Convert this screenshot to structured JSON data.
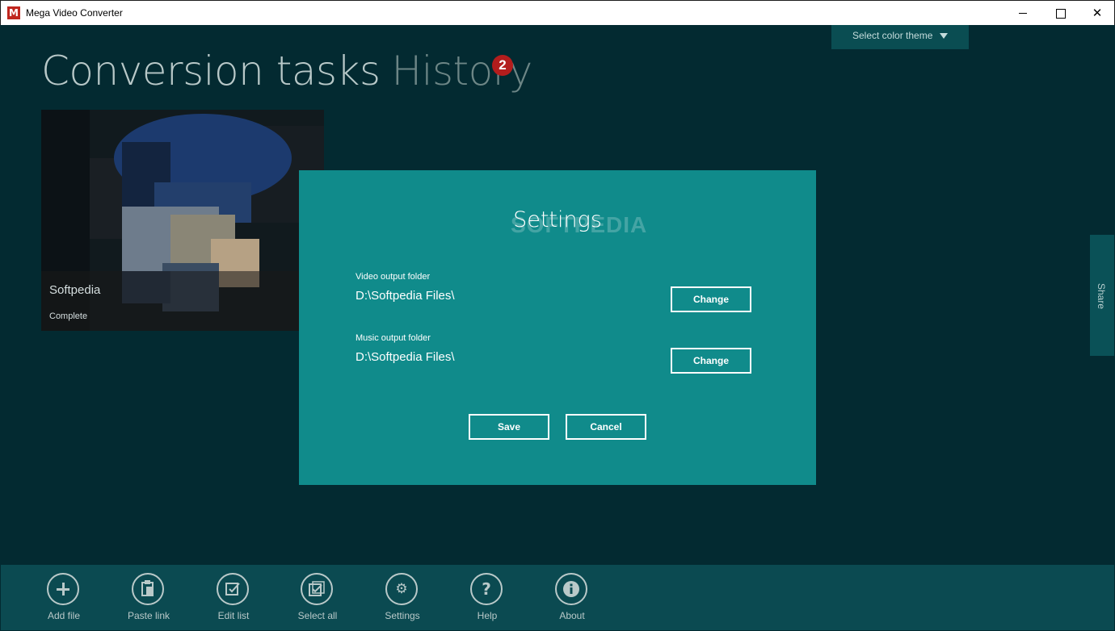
{
  "window": {
    "title": "Mega Video Converter",
    "icon_letter": "M",
    "controls": [
      "minimize",
      "maximize",
      "close"
    ]
  },
  "header": {
    "theme_select_label": "Select color theme",
    "tab_tasks": "Conversion tasks",
    "tab_history": "History",
    "history_badge": "2"
  },
  "task": {
    "name": "Softpedia",
    "status": "Complete"
  },
  "share": {
    "label": "Share"
  },
  "dialog": {
    "title": "Settings",
    "watermark": "SOFTPEDIA",
    "video_label": "Video output folder",
    "video_path": "D:\\Softpedia Files\\",
    "video_change": "Change",
    "music_label": "Music output folder",
    "music_path": "D:\\Softpedia Files\\",
    "music_change": "Change",
    "save": "Save",
    "cancel": "Cancel"
  },
  "toolbar": {
    "items": [
      {
        "label": "Add file",
        "icon": "plus-icon"
      },
      {
        "label": "Paste link",
        "icon": "paste-icon"
      },
      {
        "label": "Edit list",
        "icon": "edit-list-icon"
      },
      {
        "label": "Select all",
        "icon": "select-all-icon"
      },
      {
        "label": "Settings",
        "icon": "gear-icon"
      },
      {
        "label": "Help",
        "icon": "help-icon"
      },
      {
        "label": "About",
        "icon": "info-icon"
      }
    ]
  },
  "colors": {
    "background": "#032a31",
    "dialog": "#108b8b",
    "toolbar": "#0b4a51",
    "badge": "#b31d1d",
    "title_text": "#b8c8c8"
  }
}
